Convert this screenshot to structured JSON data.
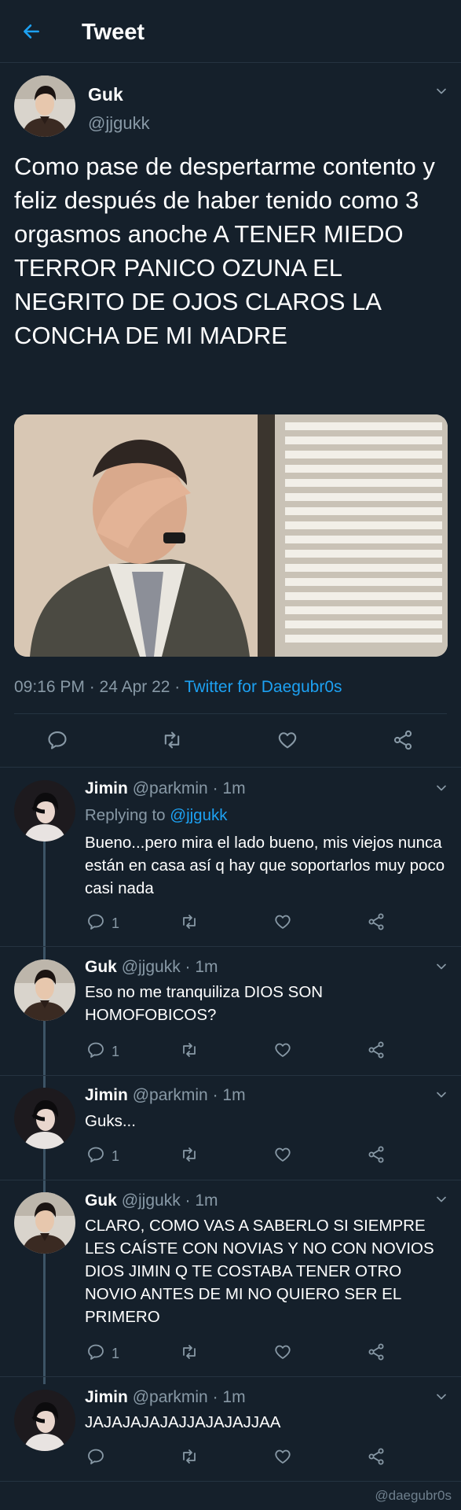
{
  "header": {
    "title": "Tweet"
  },
  "tweet": {
    "name": "Guk",
    "handle": "@jjgukk",
    "text": "Como pase de despertarme contento y feliz después de haber tenido como 3 orgasmos anoche A TENER MIEDO TERROR PANICO OZUNA EL NEGRITO DE OJOS CLAROS LA CONCHA DE MI MADRE",
    "time": "09:16 PM · 24 Apr 22 · ",
    "source": "Twitter for Daegubr0s"
  },
  "replies": [
    {
      "name": "Jimin",
      "handle": "@parkmin",
      "time": "· 1m",
      "replying_prefix": "Replying to",
      "replying_to": "@jjgukk",
      "text": "Bueno...pero mira el lado bueno, mis viejos nunca están en casa así q hay que soportarlos muy poco casi nada",
      "reply_count": "1"
    },
    {
      "name": "Guk",
      "handle": "@jjgukk",
      "time": "· 1m",
      "text": "Eso no me tranquiliza DIOS SON HOMOFOBICOS?",
      "reply_count": "1"
    },
    {
      "name": "Jimin",
      "handle": "@parkmin",
      "time": "· 1m",
      "text": "Guks...",
      "reply_count": "1"
    },
    {
      "name": "Guk",
      "handle": "@jjgukk",
      "time": "· 1m",
      "text": "CLARO, COMO VAS A SABERLO SI SIEMPRE LES CAÍSTE CON NOVIAS Y NO CON NOVIOS DIOS JIMIN Q TE COSTABA TENER OTRO NOVIO ANTES DE MI NO QUIERO SER EL PRIMERO",
      "reply_count": "1"
    },
    {
      "name": "Jimin",
      "handle": "@parkmin",
      "time": "· 1m",
      "text": "JAJAJAJAJAJJAJAJAJJAA",
      "reply_count": ""
    }
  ],
  "watermark": "@daegubr0s",
  "colors": {
    "background": "#15202b",
    "accent": "#1da1f2",
    "muted": "#8899a6",
    "divider": "#253341"
  },
  "icons": [
    "back-arrow-icon",
    "chevron-down-icon",
    "reply-icon",
    "retweet-icon",
    "like-icon",
    "share-icon"
  ]
}
